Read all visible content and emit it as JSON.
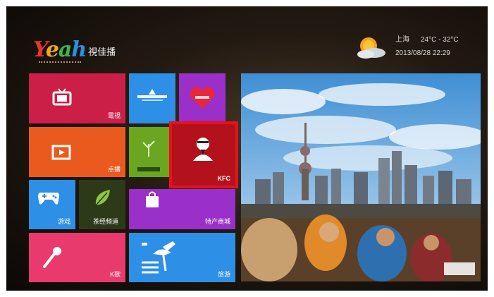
{
  "logo": {
    "brand": "Yeah",
    "cn": "視佳播"
  },
  "weather": {
    "city": "上海",
    "temp": "24°C - 32°C",
    "datetime": "2013/08/28 22:29",
    "icon": "sun-cloud-icon"
  },
  "tiles": {
    "tv": "電視",
    "vod": "点播",
    "games": "游戏",
    "tea": "茶经频道",
    "shopping": "特产商城",
    "kfc": "KFC",
    "karaoke": "K歌",
    "travel": "旅游"
  },
  "colors": {
    "crimson": "#cc1f48",
    "blue": "#2d8fe6",
    "purple": "#9a2fc9",
    "orange": "#ea5a1f",
    "green": "#6aa620",
    "pink": "#e83a6c",
    "highlight": "#e8101a"
  }
}
